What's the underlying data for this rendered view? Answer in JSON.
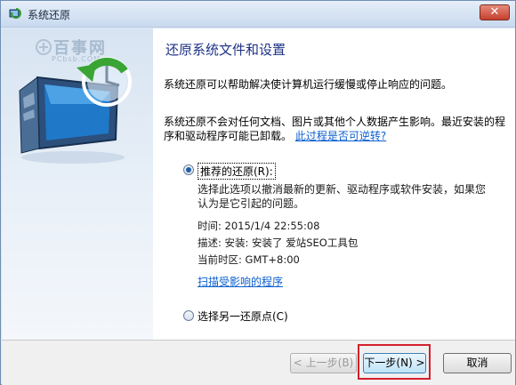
{
  "window": {
    "title": "系统还原",
    "close_label": "✕"
  },
  "sidebar": {
    "watermark_text": "百事网",
    "watermark_url": "PCbsb.COM"
  },
  "main": {
    "heading": "还原系统文件和设置",
    "intro": "系统还原可以帮助解决使计算机运行缓慢或停止响应的问题。",
    "info_text": "系统还原不会对任何文档、图片或其他个人数据产生影响。最近安装的程序和驱动程序可能已卸载。",
    "reversible_link": "此过程是否可逆转?",
    "options": {
      "recommended": {
        "label": "推荐的还原(R):",
        "checked": true,
        "description": "选择此选项以撤消最新的更新、驱动程序或软件安装，如果您认为是它引起的问题。",
        "time": "时间: 2015/1/4 22:55:08",
        "desc": "描述: 安装: 安装了 爱站SEO工具包",
        "timezone": "当前时区: GMT+8:00",
        "scan_link": "扫描受影响的程序"
      },
      "choose_other": {
        "label": "选择另一还原点(C)",
        "checked": false
      }
    }
  },
  "footer": {
    "back_label": "< 上一步(B)",
    "next_label": "下一步(N) >",
    "cancel_label": "取消"
  },
  "colors": {
    "heading": "#1e3287",
    "link": "#0b5fcf",
    "highlight": "#d4202c"
  }
}
